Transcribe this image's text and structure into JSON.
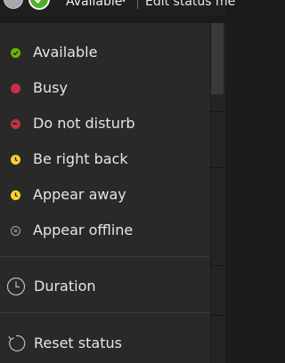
{
  "header": {
    "status_label": "Available",
    "chevron": "▾",
    "edit_status_label": "Edit status me"
  },
  "menu": {
    "items": [
      {
        "label": "Available",
        "icon": "available-status-icon",
        "color": "#6bb700"
      },
      {
        "label": "Busy",
        "icon": "busy-status-icon",
        "color": "#c4314b"
      },
      {
        "label": "Do not disturb",
        "icon": "do-not-disturb-status-icon",
        "color": "#c4314b"
      },
      {
        "label": "Be right back",
        "icon": "be-right-back-status-icon",
        "color": "#f8d22a"
      },
      {
        "label": "Appear away",
        "icon": "appear-away-status-icon",
        "color": "#f8d22a"
      },
      {
        "label": "Appear offline",
        "icon": "appear-offline-status-icon",
        "color": "#a8a8a8"
      }
    ],
    "duration_label": "Duration",
    "reset_label": "Reset status"
  }
}
